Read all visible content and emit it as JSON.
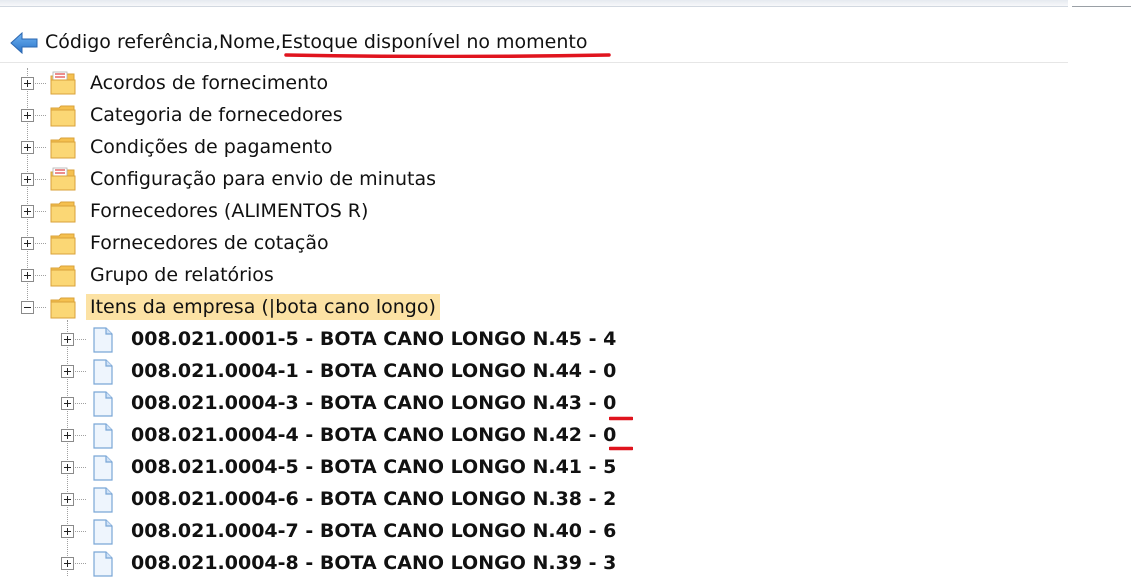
{
  "path_bar": {
    "text": "Código referência,Nome,Estoque disponível no momento",
    "back_icon": "back-arrow-icon"
  },
  "tree": {
    "root_items": [
      {
        "label": "Acordos de fornecimento",
        "icon": "folder-document-icon",
        "expanded": false
      },
      {
        "label": "Categoria de fornecedores",
        "icon": "folder-icon",
        "expanded": false
      },
      {
        "label": "Condições de pagamento",
        "icon": "folder-icon",
        "expanded": false
      },
      {
        "label": "Configuração para envio de minutas",
        "icon": "folder-document-icon",
        "expanded": false
      },
      {
        "label": "Fornecedores (ALIMENTOS R)",
        "icon": "folder-icon",
        "expanded": false
      },
      {
        "label": "Fornecedores de cotação",
        "icon": "folder-icon",
        "expanded": false
      },
      {
        "label": "Grupo de relatórios",
        "icon": "folder-icon",
        "expanded": false
      },
      {
        "label": "Itens da empresa (|bota cano longo)",
        "icon": "folder-icon",
        "expanded": true,
        "selected": true
      }
    ],
    "child_items": [
      {
        "label": "008.021.0001-5 - BOTA CANO LONGO N.45 - 4",
        "icon": "document-icon"
      },
      {
        "label": "008.021.0004-1 - BOTA CANO LONGO N.44 - 0",
        "icon": "document-icon"
      },
      {
        "label": "008.021.0004-3 - BOTA CANO LONGO N.43 - 0",
        "icon": "document-icon",
        "marked": true
      },
      {
        "label": "008.021.0004-4 - BOTA CANO LONGO N.42 - 0",
        "icon": "document-icon",
        "marked": true
      },
      {
        "label": "008.021.0004-5 - BOTA CANO LONGO N.41 - 5",
        "icon": "document-icon"
      },
      {
        "label": "008.021.0004-6 - BOTA CANO LONGO N.38 - 2",
        "icon": "document-icon"
      },
      {
        "label": "008.021.0004-7 - BOTA CANO LONGO N.40 - 6",
        "icon": "document-icon"
      },
      {
        "label": "008.021.0004-8 - BOTA CANO LONGO N.39 - 3",
        "icon": "document-icon"
      }
    ]
  },
  "colors": {
    "selection": "#fce2a4",
    "folder": "#f7c85a",
    "annotation_red": "#e0141e",
    "arrow_blue": "#2f7fd6"
  }
}
